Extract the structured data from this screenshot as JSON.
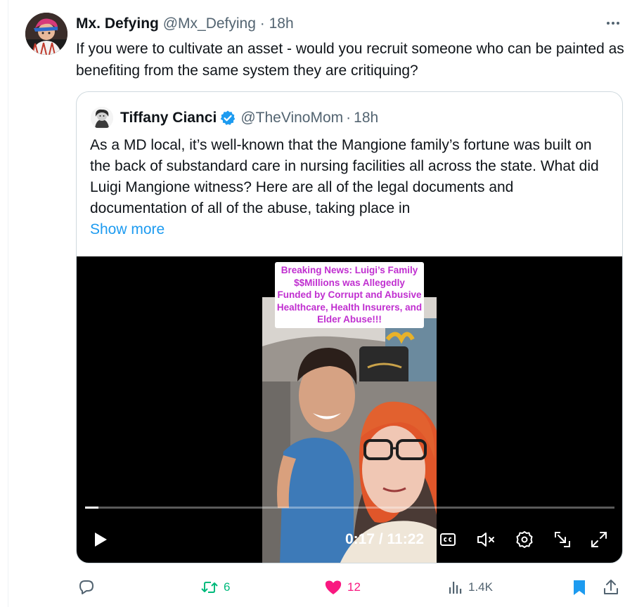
{
  "tweet": {
    "author_name": "Mx. Defying",
    "author_handle": "@Mx_Defying",
    "separator": "·",
    "time": "18h",
    "text": "If you were to cultivate an asset - would you recruit someone who can be painted as benefiting from the same system they are critiquing?"
  },
  "quoted": {
    "author_name": "Tiffany Cianci",
    "author_handle": "@TheVinoMom",
    "separator": "·",
    "time": "18h",
    "text": "As a MD local, it’s well-known that the Mangione family’s fortune was built on the back of substandard care in nursing facilities all across the state. What did Luigi Mangione witness? Here are all of the legal documents and documentation of all of the abuse, taking place in",
    "show_more": "Show more",
    "video": {
      "caption": "Breaking News: Luigi’s Family $$Millions was Allegedly Funded by Corrupt and Abusive Healthcare, Health Insurers, and Elder Abuse!!!",
      "time_display": "0:17 / 11:22",
      "progress_fraction": 0.025,
      "icons": [
        "play-icon",
        "closed-captions-icon",
        "mute-icon",
        "settings-icon",
        "minimize-icon",
        "fullscreen-icon"
      ]
    }
  },
  "actions": {
    "reply_count": "",
    "retweet_count": "6",
    "like_count": "12",
    "views_count": "1.4K"
  },
  "colors": {
    "text": "#0f1419",
    "muted": "#536471",
    "link": "#1d9bf0",
    "retweet": "#00ba7c",
    "like": "#f91880",
    "caption_text": "#c02fd0"
  }
}
